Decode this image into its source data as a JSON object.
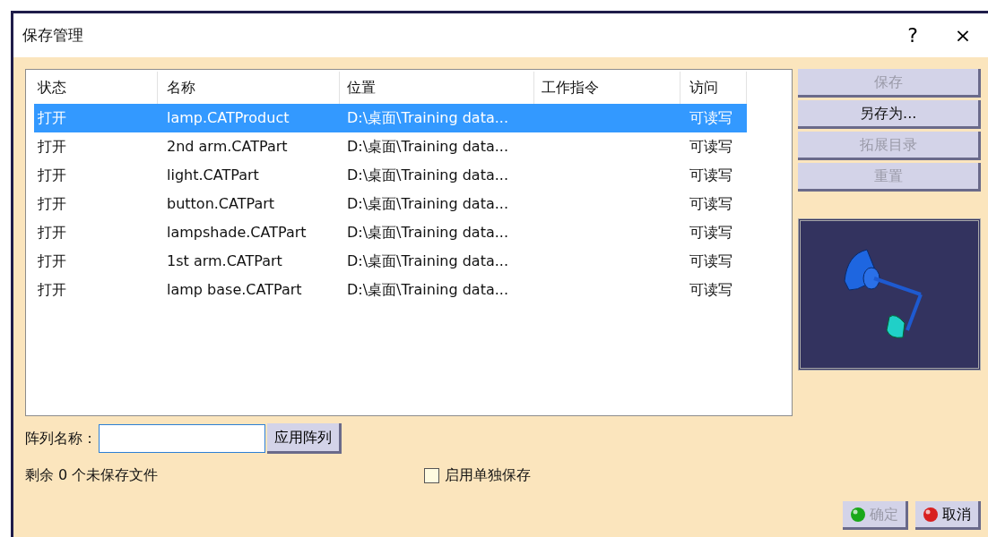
{
  "window": {
    "title": "保存管理",
    "help": "?",
    "close": "×"
  },
  "table": {
    "columns": [
      "状态",
      "名称",
      "位置",
      "工作指令",
      "访问"
    ],
    "rows": [
      {
        "status": "打开",
        "name": "lamp.CATProduct",
        "location": "D:\\桌面\\Training data...",
        "access": "可读写",
        "selected": true
      },
      {
        "status": "打开",
        "name": "2nd arm.CATPart",
        "location": "D:\\桌面\\Training data...",
        "access": "可读写",
        "selected": false
      },
      {
        "status": "打开",
        "name": "light.CATPart",
        "location": "D:\\桌面\\Training data...",
        "access": "可读写",
        "selected": false
      },
      {
        "status": "打开",
        "name": "button.CATPart",
        "location": "D:\\桌面\\Training data...",
        "access": "可读写",
        "selected": false
      },
      {
        "status": "打开",
        "name": "lampshade.CATPart",
        "location": "D:\\桌面\\Training data...",
        "access": "可读写",
        "selected": false
      },
      {
        "status": "打开",
        "name": "1st arm.CATPart",
        "location": "D:\\桌面\\Training data...",
        "access": "可读写",
        "selected": false
      },
      {
        "status": "打开",
        "name": "lamp base.CATPart",
        "location": "D:\\桌面\\Training data...",
        "access": "可读写",
        "selected": false
      }
    ]
  },
  "side_buttons": [
    {
      "label": "保存",
      "disabled": true
    },
    {
      "label": "另存为...",
      "disabled": false
    },
    {
      "label": "拓展目录",
      "disabled": true
    },
    {
      "label": "重置",
      "disabled": true
    }
  ],
  "array": {
    "label": "阵列名称：",
    "button": "应用阵列"
  },
  "remaining": "剩余 0 个未保存文件",
  "individual_save": {
    "label": "启用单独保存",
    "checked": false
  },
  "footer_buttons": [
    {
      "label": "确定",
      "kind": "ok",
      "disabled": true
    },
    {
      "label": "取消",
      "kind": "cancel",
      "disabled": false
    }
  ]
}
